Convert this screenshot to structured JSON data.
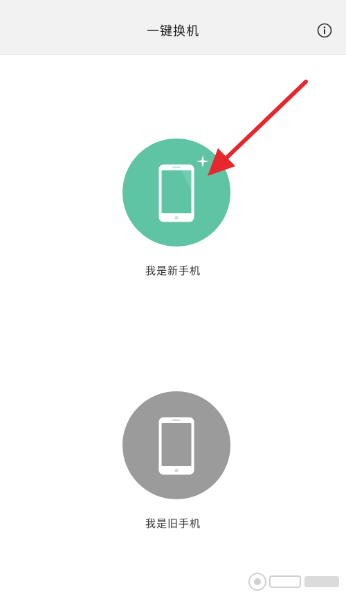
{
  "header": {
    "title": "一键换机",
    "info_icon": "info-icon"
  },
  "options": {
    "new_phone": {
      "label": "我是新手机",
      "icon": "phone-icon",
      "color": "#5ec4a3"
    },
    "old_phone": {
      "label": "我是旧手机",
      "icon": "phone-icon",
      "color": "#9b9b9b"
    }
  },
  "annotation": {
    "icon": "red-arrow-icon",
    "color": "#e8262d"
  },
  "watermark": {
    "icon": "baidu-jingyan-watermark"
  }
}
